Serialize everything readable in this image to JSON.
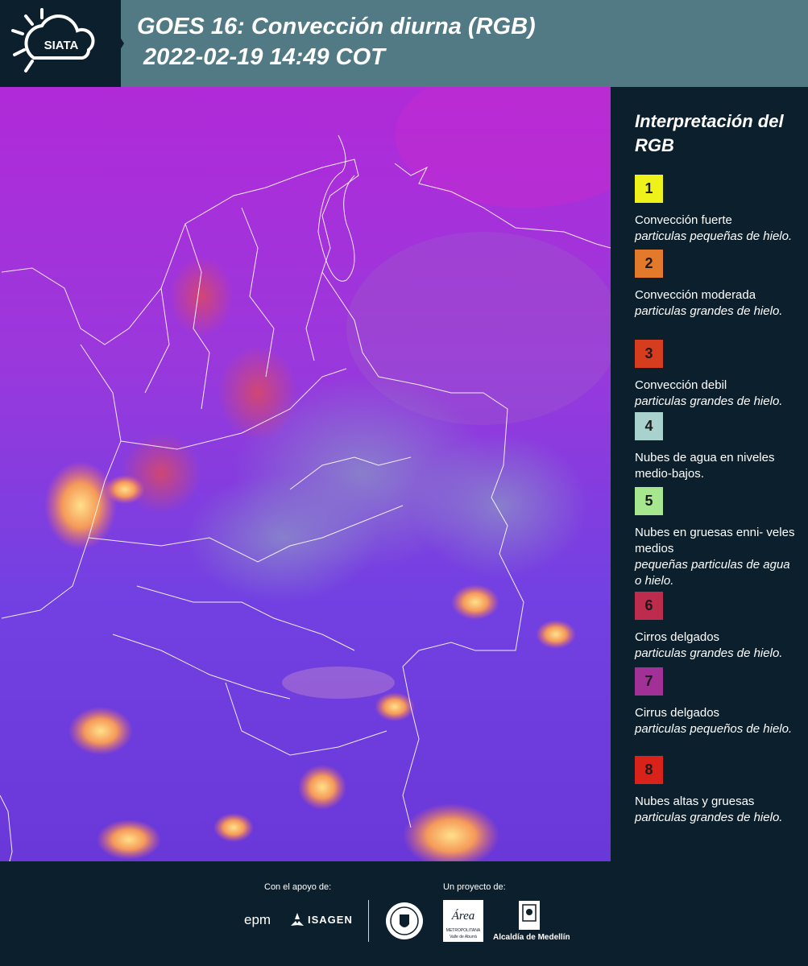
{
  "header": {
    "logo_text": "SIATA",
    "title_line1": "GOES 16: Convección diurna (RGB)",
    "title_line2": " 2022-02-19 14:49 COT"
  },
  "legend": {
    "title": "Interpretación del RGB",
    "items": [
      {
        "num": "1",
        "color": "#eef21a",
        "label": "Convección fuerte",
        "sub": "particulas pequeñas de hielo."
      },
      {
        "num": "2",
        "color": "#e2792b",
        "label": "Convección moderada",
        "sub": "particulas grandes de hielo."
      },
      {
        "num": "3",
        "color": "#d63d1e",
        "label": "Convección debil",
        "sub": "particulas grandes de hielo."
      },
      {
        "num": "4",
        "color": "#a9d2cf",
        "label": "Nubes de agua en niveles medio-bajos.",
        "sub": ""
      },
      {
        "num": "5",
        "color": "#a5e68f",
        "label": "Nubes en gruesas enni- veles medios",
        "sub": "pequeñas particulas de agua o hielo."
      },
      {
        "num": "6",
        "color": "#bd2b4d",
        "label": "Cirros delgados",
        "sub": "particulas grandes de hielo."
      },
      {
        "num": "7",
        "color": "#a13196",
        "label": "Cirrus delgados",
        "sub": "particulas pequeños de hielo."
      },
      {
        "num": "8",
        "color": "#d9221a",
        "label": "Nubes altas y gruesas",
        "sub": "particulas grandes de hielo."
      }
    ]
  },
  "footer": {
    "support_label": "Con el apoyo de:",
    "project_label": "Un proyecto de:",
    "epm": "epm",
    "isagen": "ISAGEN",
    "area_logo": "Área",
    "area_text": "METROPOLITANA",
    "area_sub": "Valle de Aburrá",
    "alcaldia": "Alcaldía de Medellín"
  }
}
